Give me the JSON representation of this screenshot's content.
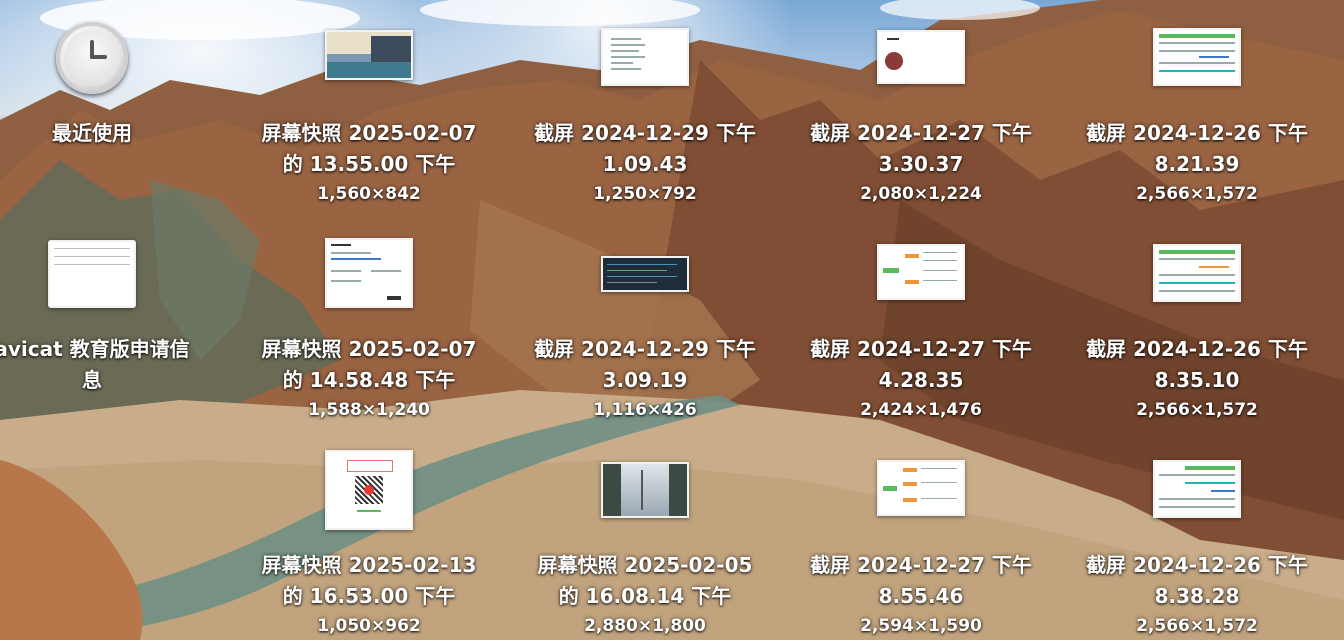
{
  "desktop": {
    "icons": [
      {
        "id": "recents",
        "label_lines": [
          "最近使用"
        ],
        "dims": "",
        "kind": "clock"
      },
      {
        "id": "s1",
        "label_lines": [
          "屏幕快照 2025-02-07",
          "的 13.55.00 下午"
        ],
        "dims": "1,560×842",
        "kind": "city"
      },
      {
        "id": "s2",
        "label_lines": [
          "截屏 2024-12-29 下午",
          "1.09.43"
        ],
        "dims": "1,250×792",
        "kind": "doc"
      },
      {
        "id": "s3",
        "label_lines": [
          "截屏 2024-12-27 下午",
          "3.30.37"
        ],
        "dims": "2,080×1,224",
        "kind": "avatar"
      },
      {
        "id": "s4",
        "label_lines": [
          "截屏 2024-12-26 下午",
          "8.21.39"
        ],
        "dims": "2,566×1,572",
        "kind": "table"
      },
      {
        "id": "navicat",
        "label_lines": [
          "avicat 教育版申请信",
          "息"
        ],
        "dims": "",
        "kind": "sheet"
      },
      {
        "id": "s5",
        "label_lines": [
          "屏幕快照 2025-02-07",
          "的 14.58.48 下午"
        ],
        "dims": "1,588×1,240",
        "kind": "doc2"
      },
      {
        "id": "s6",
        "label_lines": [
          "截屏 2024-12-29 下午",
          "3.09.19"
        ],
        "dims": "1,116×426",
        "kind": "code"
      },
      {
        "id": "s7",
        "label_lines": [
          "截屏 2024-12-27 下午",
          "4.28.35"
        ],
        "dims": "2,424×1,476",
        "kind": "mindmap"
      },
      {
        "id": "s8",
        "label_lines": [
          "截屏 2024-12-26 下午",
          "8.35.10"
        ],
        "dims": "2,566×1,572",
        "kind": "table"
      },
      {
        "id": "s9",
        "label_lines": [
          "屏幕快照 2025-02-13",
          "的 16.53.00 下午"
        ],
        "dims": "1,050×962",
        "kind": "qr"
      },
      {
        "id": "s10",
        "label_lines": [
          "屏幕快照 2025-02-05",
          "的 16.08.14 下午"
        ],
        "dims": "2,880×1,800",
        "kind": "snow"
      },
      {
        "id": "s11",
        "label_lines": [
          "截屏 2024-12-27 下午",
          "8.55.46"
        ],
        "dims": "2,594×1,590",
        "kind": "mindmap"
      },
      {
        "id": "s12",
        "label_lines": [
          "截屏 2024-12-26 下午",
          "8.38.28"
        ],
        "dims": "2,566×1,572",
        "kind": "table2"
      }
    ]
  },
  "colors": {
    "label_text": "#ffffff",
    "sky": "#a9c6e3",
    "rock": "#8a5a3c",
    "sand": "#c9ad8a",
    "river": "#6f8f84"
  }
}
